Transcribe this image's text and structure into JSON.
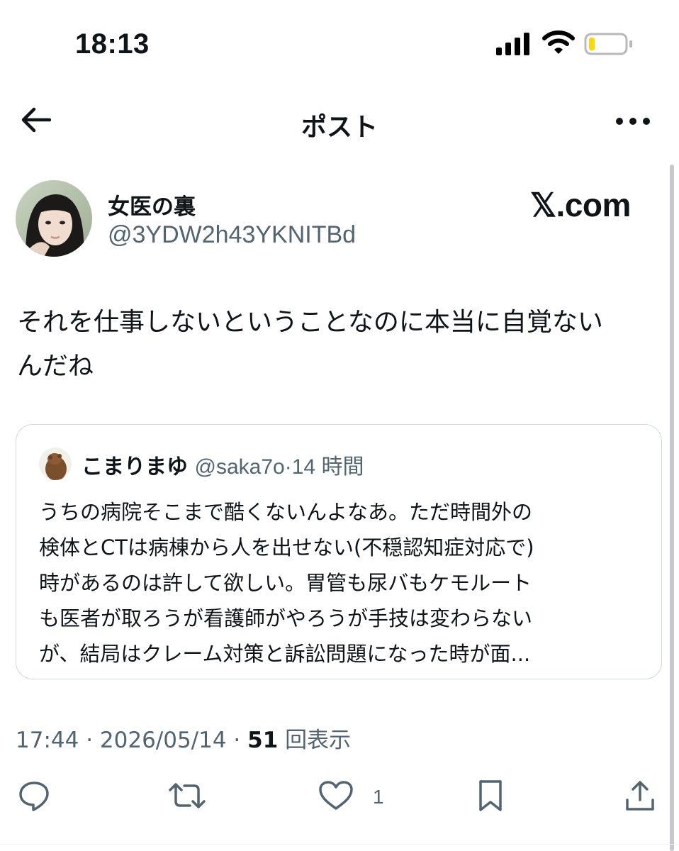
{
  "status_bar": {
    "time": "18:13"
  },
  "header": {
    "title": "ポスト",
    "back_icon": "arrow-left-icon",
    "more_icon": "more-horizontal-icon"
  },
  "post": {
    "author": {
      "name": "女医の裏",
      "handle": "@3YDW2h43YKNITBd"
    },
    "watermark": "𝕏.com",
    "text_line1": "それを仕事しないということなのに本当に自覚ない",
    "text_line2": "んだね",
    "timestamp": "17:44 · 2026/05/14 · ",
    "views_count": "51",
    "views_label": " 回表示"
  },
  "quoted_post": {
    "author_name": "こまりまゆ",
    "handle": "@saka7o",
    "separator": "·",
    "time_ago": "14 時間",
    "lines": [
      "うちの病院そこまで酷くないんよなあ。ただ時間外の",
      "検体とCTは病棟から人を出せない(不穏認知症対応で)",
      "時があるのは許して欲しい。胃管も尿バもケモルート",
      "も医者が取ろうが看護師がやろうが手技は変わらない",
      "が、結局はクレーム対策と訴訟問題になった時が面..."
    ]
  },
  "actions": {
    "reply_icon": "reply-icon",
    "repost_icon": "repost-icon",
    "like_icon": "heart-icon",
    "like_count": "1",
    "bookmark_icon": "bookmark-icon",
    "share_icon": "share-icon"
  },
  "colors": {
    "text": "#0f1419",
    "secondary": "#536471",
    "border": "#cfd9de",
    "battery_fill": "#ffd60a"
  }
}
